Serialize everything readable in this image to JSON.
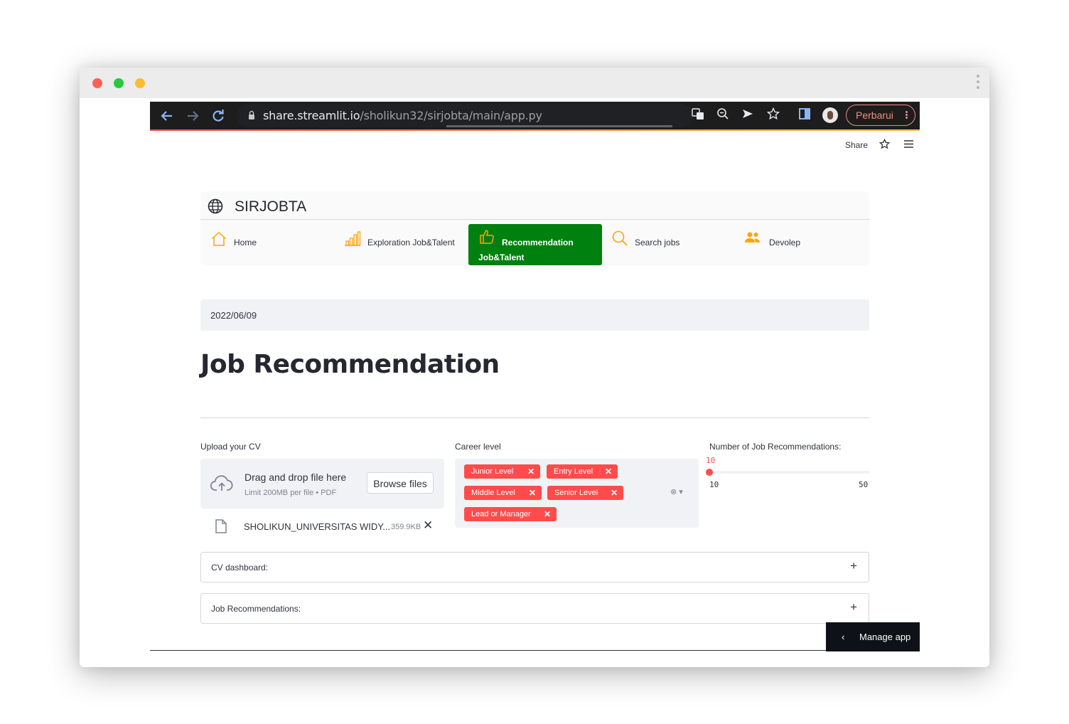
{
  "browser": {
    "url_host": "share.streamlit.io",
    "url_path": "/sholikun32/sirjobta/main/app.py",
    "update_label": "Perbarui"
  },
  "toolbar": {
    "share_label": "Share"
  },
  "brand": {
    "title": "SIRJOBTA"
  },
  "menu": {
    "items": [
      {
        "label": "Home",
        "icon": "home-icon",
        "active": false
      },
      {
        "label": "Exploration Job&Talent",
        "icon": "bar-chart-icon",
        "active": false
      },
      {
        "label_line1": "Recommendation",
        "label_line2": "Job&Talent",
        "icon": "thumbs-up-icon",
        "active": true
      },
      {
        "label": "Search jobs",
        "icon": "search-icon",
        "active": false
      },
      {
        "label": "Devolep",
        "icon": "people-icon",
        "active": false
      }
    ],
    "accent_color": "#00800e",
    "icon_color": "#ffa500"
  },
  "date": "2022/06/09",
  "page_title": "Job Recommendation",
  "upload": {
    "label": "Upload your CV",
    "drop_text": "Drag and drop file here",
    "limit_text": "Limit 200MB per file • PDF",
    "browse_label": "Browse files",
    "file_name": "SHOLIKUN_UNIVERSITAS WIDY...",
    "file_size": "359.9KB",
    "remove_glyph": "✕"
  },
  "career": {
    "label": "Career level",
    "selected": [
      "Junior Level",
      "Entry Level",
      "Middle Level",
      "Senior Level",
      "Lead or Manager"
    ],
    "remove_glyph": "✕",
    "control_glyph": "⊗ ▾",
    "tag_color": "#ff4b4b"
  },
  "slider": {
    "label": "Number of Job Recommendations:",
    "value": "10",
    "min": "10",
    "max": "50",
    "accent_color": "#ff4b4b"
  },
  "expanders": {
    "cv_dashboard": "CV dashboard:",
    "job_recommendations": "Job Recommendations:",
    "plus_glyph": "+"
  },
  "manage": {
    "label": "Manage app",
    "chevron": "‹"
  }
}
